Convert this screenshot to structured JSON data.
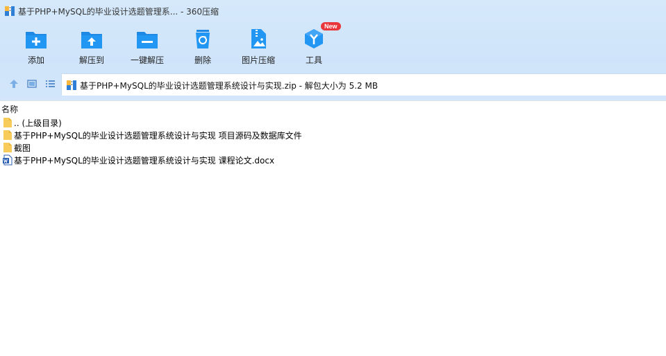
{
  "window": {
    "title": "基于PHP+MySQL的毕业设计选题管理系... - 360压缩"
  },
  "toolbar": {
    "items": [
      {
        "label": "添加",
        "icon": "add-icon"
      },
      {
        "label": "解压到",
        "icon": "extract-to-icon"
      },
      {
        "label": "一键解压",
        "icon": "one-click-extract-icon"
      },
      {
        "label": "删除",
        "icon": "delete-icon"
      },
      {
        "label": "图片压缩",
        "icon": "image-compress-icon"
      },
      {
        "label": "工具",
        "icon": "tools-icon",
        "badge": "New"
      }
    ]
  },
  "address": {
    "path": "基于PHP+MySQL的毕业设计选题管理系统设计与实现.zip - 解包大小为 5.2 MB"
  },
  "list": {
    "header": "名称",
    "rows": [
      {
        "name": ".. (上级目录)",
        "icon": "folder-icon"
      },
      {
        "name": "基于PHP+MySQL的毕业设计选题管理系统设计与实现 项目源码及数据库文件",
        "icon": "folder-icon"
      },
      {
        "name": "截图",
        "icon": "folder-icon"
      },
      {
        "name": "基于PHP+MySQL的毕业设计选题管理系统设计与实现 课程论文.docx",
        "icon": "word-doc-icon"
      }
    ]
  },
  "colors": {
    "accent": "#1e88e5",
    "toolbar_bg": "#d3e6fb",
    "badge": "#e8363b"
  }
}
